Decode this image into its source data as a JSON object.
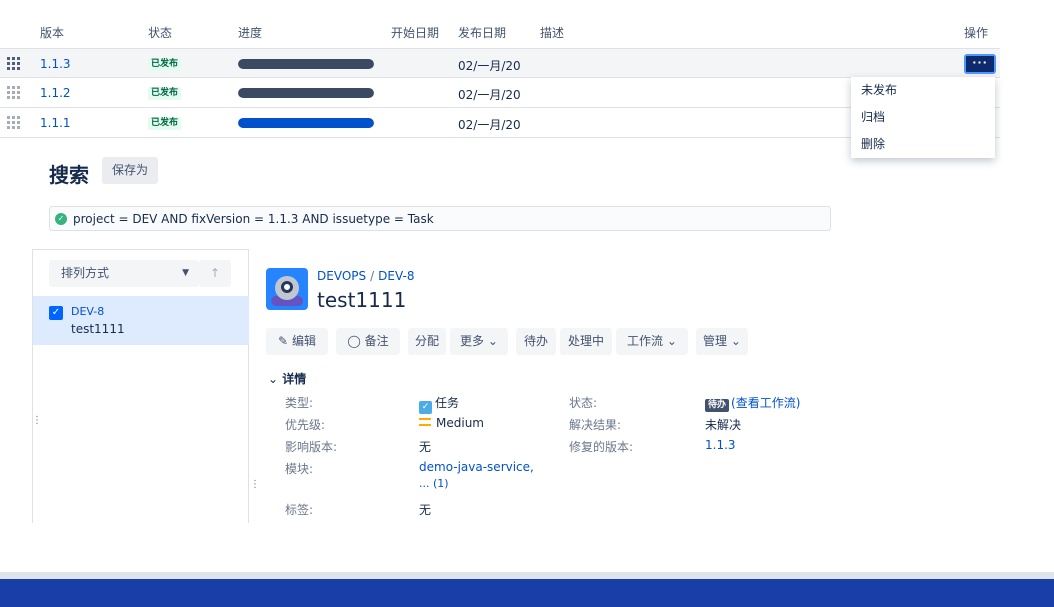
{
  "versions": {
    "headers": {
      "version": "版本",
      "status": "状态",
      "progress": "进度",
      "start_date": "开始日期",
      "release_date": "发布日期",
      "description": "描述",
      "actions": "操作"
    },
    "rows": [
      {
        "name": "1.1.3",
        "status": "已发布",
        "progress": 1.0,
        "bar_color": "#3b4a62",
        "release_date": "02/一月/20"
      },
      {
        "name": "1.1.2",
        "status": "已发布",
        "progress": 1.0,
        "bar_color": "#3b4a62",
        "release_date": "02/一月/20"
      },
      {
        "name": "1.1.1",
        "status": "已发布",
        "progress": 1.0,
        "bar_color": "#0052cc",
        "release_date": "02/一月/20"
      }
    ],
    "more_button": "···",
    "menu": [
      "未发布",
      "归档",
      "删除"
    ]
  },
  "search": {
    "title": "搜索",
    "save_as": "保存为",
    "jql": "project = DEV AND fixVersion = 1.1.3  AND issuetype = Task",
    "sort_label": "排列方式",
    "results": [
      {
        "key": "DEV-8",
        "summary": "test1111"
      }
    ]
  },
  "issue": {
    "project": "DEVOPS",
    "key": "DEV-8",
    "summary": "test1111",
    "toolbar": {
      "edit": "编辑",
      "comment": "备注",
      "assign": "分配",
      "more": "更多",
      "todo": "待办",
      "in_progress": "处理中",
      "workflow": "工作流",
      "admin": "管理"
    },
    "details_title": "详情",
    "fields": {
      "type_label": "类型:",
      "type_value": "任务",
      "priority_label": "优先级:",
      "priority_value": "Medium",
      "affects_label": "影响版本:",
      "affects_value": "无",
      "component_label": "模块:",
      "component_value": "demo-java-service,",
      "component_more": "... (1)",
      "labels_label": "标签:",
      "labels_value": "无",
      "status_label": "状态:",
      "status_badge": "待办",
      "status_link": "(查看工作流)",
      "resolution_label": "解决结果:",
      "resolution_value": "未解决",
      "fix_label": "修复的版本:",
      "fix_value": "1.1.3"
    }
  }
}
